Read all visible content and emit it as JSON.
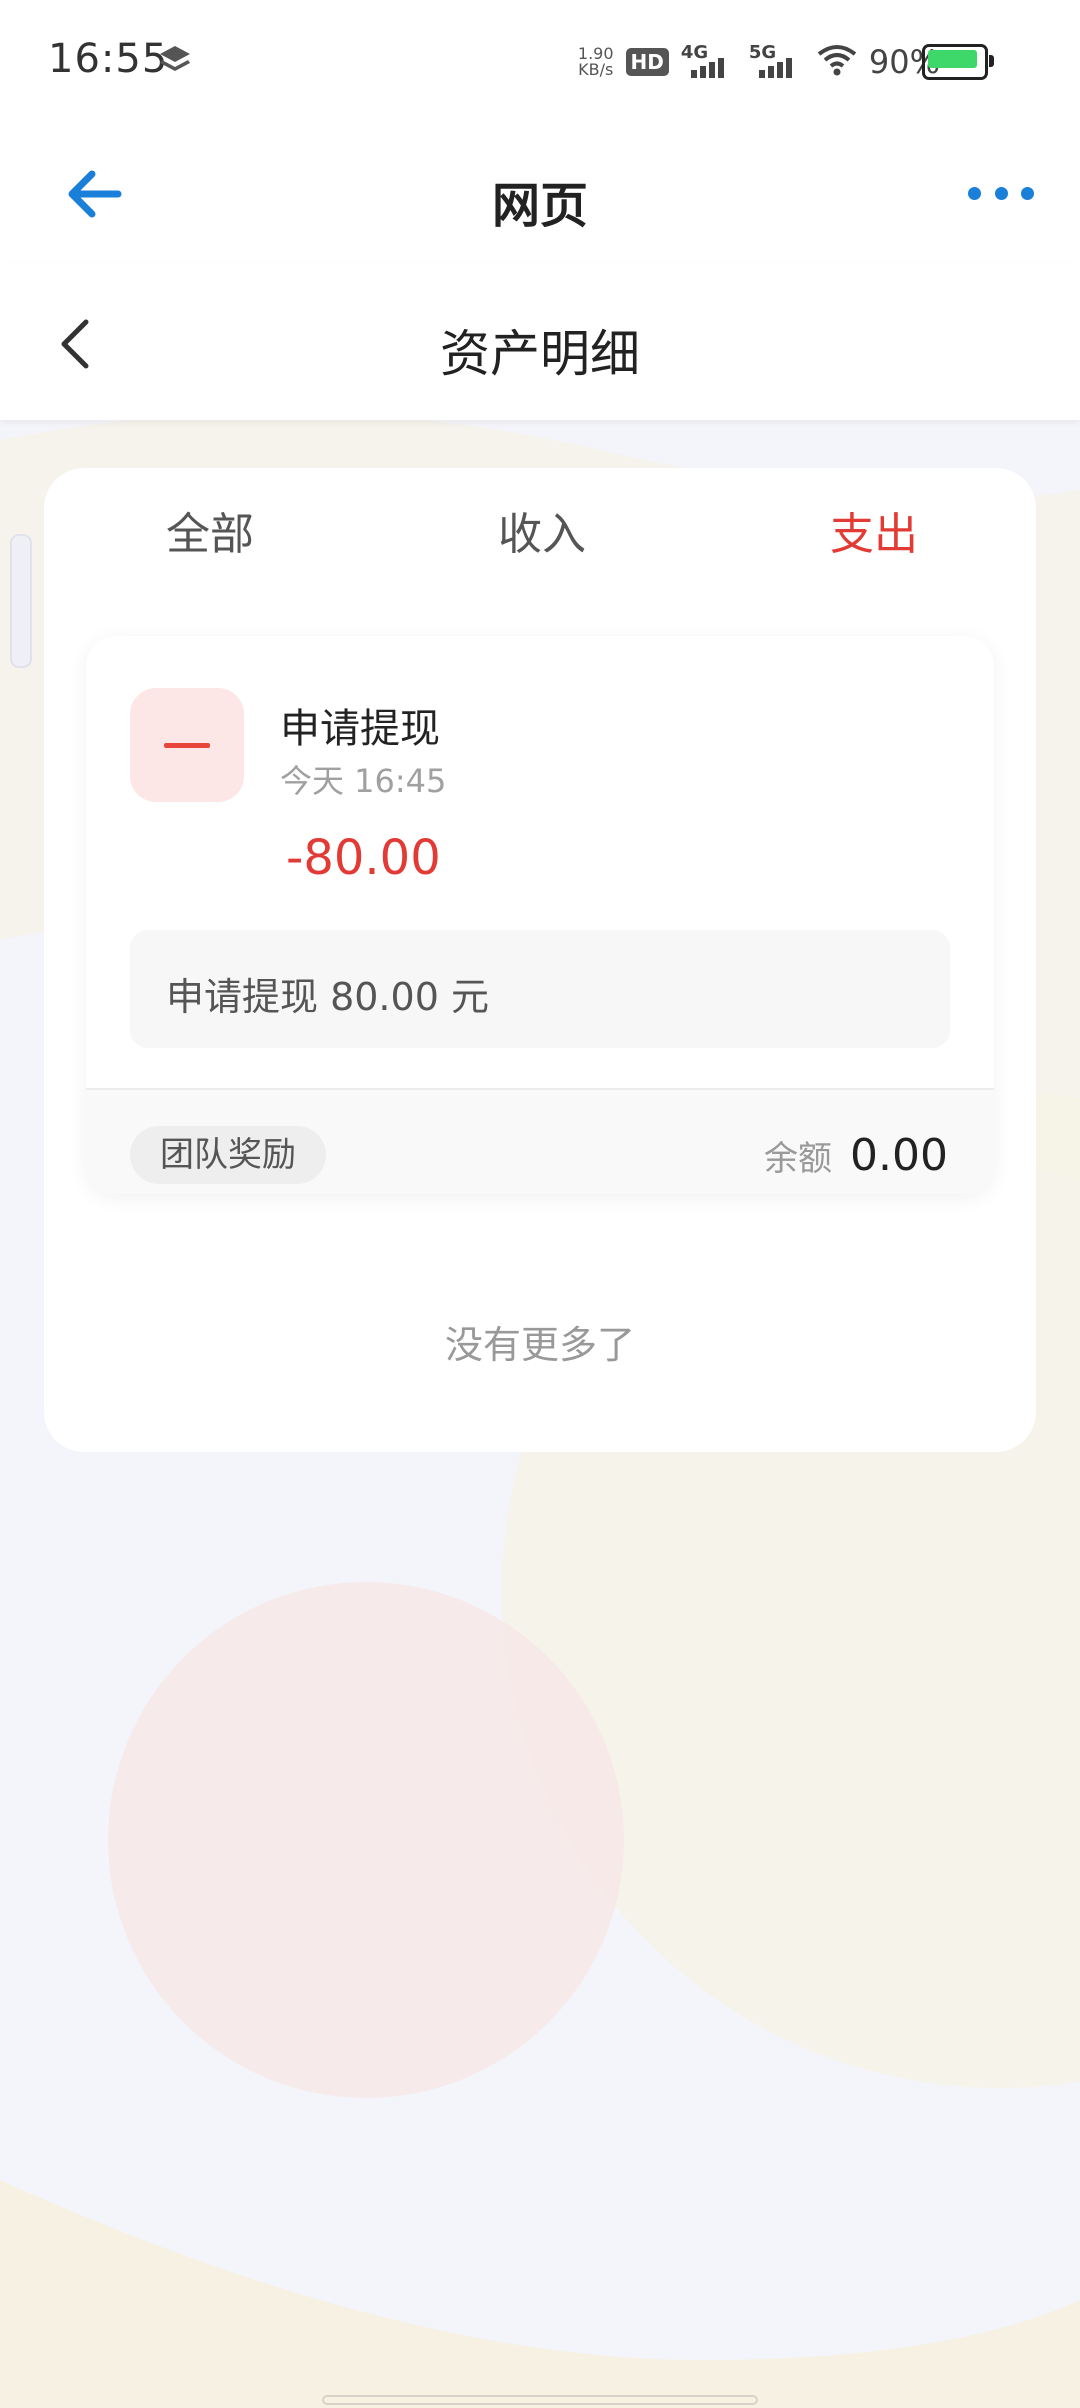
{
  "status_bar": {
    "time": "16:55",
    "net_speed_value": "1.90",
    "net_speed_unit": "KB/s",
    "hd_label": "HD",
    "signal_1_label": "4G",
    "signal_2_label": "5G",
    "battery_percent": "90%",
    "battery_level": 0.9,
    "icons": [
      "layers-icon",
      "hd-icon",
      "signal-4g-icon",
      "signal-5g-icon",
      "wifi-icon",
      "battery-icon"
    ]
  },
  "app_bar": {
    "title": "网页",
    "back_icon": "arrow-left-icon",
    "more_icon": "more-dots-icon",
    "accent_color": "#1a7fd8"
  },
  "page_header": {
    "title": "资产明细",
    "back_icon": "chevron-left-icon"
  },
  "tabs": [
    {
      "label": "全部",
      "active": false
    },
    {
      "label": "收入",
      "active": false
    },
    {
      "label": "支出",
      "active": true
    }
  ],
  "entries": [
    {
      "icon": "minus-icon",
      "title": "申请提现",
      "time": "今天 16:45",
      "amount": "-80.00",
      "description": "申请提现 80.00 元",
      "tag": "团队奖励",
      "balance_label": "余额",
      "balance_value": "0.00"
    }
  ],
  "list_end_text": "没有更多了",
  "colors": {
    "expense_red": "#e23a35",
    "icon_bg": "#fde6e6",
    "page_bg": "#f4f5fa"
  }
}
